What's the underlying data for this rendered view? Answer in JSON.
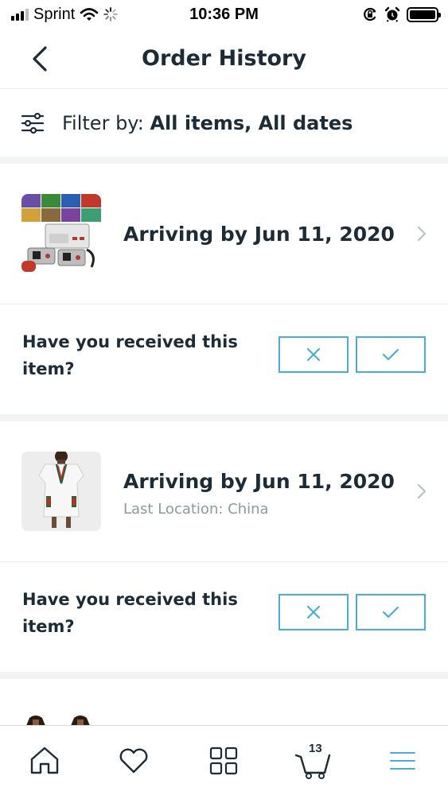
{
  "status_bar": {
    "carrier": "Sprint",
    "time": "10:36 PM",
    "icons": [
      "signal-icon",
      "wifi-icon",
      "loading-icon",
      "orientation-lock-icon",
      "alarm-icon",
      "battery-icon"
    ]
  },
  "header": {
    "title": "Order History",
    "back_icon": "back-arrow-icon"
  },
  "filter": {
    "label": "Filter by:",
    "value": "All items, All dates",
    "icon": "filter-sliders-icon"
  },
  "orders": [
    {
      "thumbnail": "retro-game-console-image",
      "status": "Arriving by Jun 11, 2020",
      "last_location": "",
      "question": "Have you received this item?"
    },
    {
      "thumbnail": "white-dress-image",
      "status": "Arriving by Jun 11, 2020",
      "last_location": "Last Location: China",
      "question": "Have you received this item?"
    }
  ],
  "bottom_nav": {
    "items": [
      "home-icon",
      "heart-icon",
      "grid-icon",
      "cart-icon",
      "menu-icon"
    ],
    "cart_count": "13"
  },
  "colors": {
    "accent": "#4aaed4",
    "text_dark": "#1d2b36",
    "text_muted": "#8e98a1",
    "divider_band": "#f1f3f5"
  }
}
